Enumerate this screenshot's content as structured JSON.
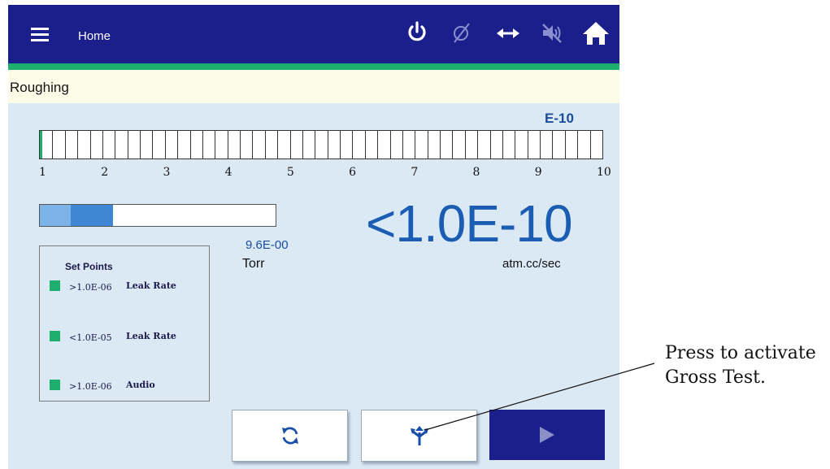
{
  "header": {
    "title": "Home",
    "icons": [
      "menu-icon",
      "power-icon",
      "null-icon",
      "horizontal-arrows-icon",
      "audio-mute-icon",
      "home-icon"
    ]
  },
  "status": {
    "text": "Roughing"
  },
  "scale": {
    "unit": "E-10",
    "labels": [
      "1",
      "2",
      "3",
      "4",
      "5",
      "6",
      "7",
      "8",
      "9",
      "10"
    ],
    "fill_fraction": 0.004,
    "fill_color": "#1eaf6e"
  },
  "level_bar": {
    "fill_light_fraction": 0.13,
    "fill_dark_fraction": 0.31,
    "light_color": "#7db4e8",
    "dark_color": "#3f86d4"
  },
  "pressure": {
    "value": "9.6E-00",
    "unit": "Torr"
  },
  "leak_rate": {
    "value": "<1.0E-10",
    "unit": "atm.cc/sec"
  },
  "set_points": {
    "title": "Set Points",
    "items": [
      {
        "value": ">1.0E-06",
        "type": "Leak Rate",
        "color": "#1eaf6e"
      },
      {
        "value": "<1.0E-05",
        "type": "Leak Rate",
        "color": "#1eaf6e"
      },
      {
        "value": ">1.0E-06",
        "type": "Audio",
        "color": "#1eaf6e"
      }
    ]
  },
  "buttons": {
    "refresh_icon": "refresh-icon",
    "gross_icon": "gross-test-icon",
    "start_icon": "play-icon"
  },
  "callout": {
    "line1": "Press to activate",
    "line2": "Gross Test."
  },
  "colors": {
    "topbar": "#1b1f8c",
    "accent_green": "#1eaf6e",
    "panel": "#dbe9f5",
    "value_blue": "#1a5db2"
  }
}
